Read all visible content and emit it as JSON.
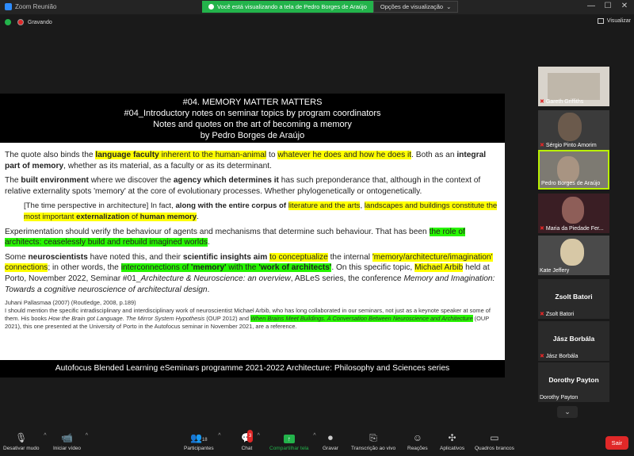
{
  "window": {
    "title": "Zoom Reunião",
    "minimize": "—",
    "maximize": "☐",
    "close": "✕"
  },
  "banner": {
    "text": "Você está visualizando a tela de Pedro Borges de Araújo",
    "options": "Opções de visualização"
  },
  "status": {
    "recording": "Gravando",
    "view": "Visualizar"
  },
  "slide": {
    "title": "#04. MEMORY MATTER MATTERS",
    "subtitle": "#04_Introductory notes on seminar topics by program coordinators",
    "subtitle2": "Notes and quotes on the art of becoming a memory",
    "author": "by Pedro Borges de Araújo",
    "footer": "Autofocus Blended Learning eSeminars programme 2021-2022 Architecture: Philosophy and Sciences series"
  },
  "participants": [
    {
      "name": "Gareth Griffiths",
      "video": true
    },
    {
      "name": "Sérgio Pinto Amorim",
      "video": true
    },
    {
      "name": "Pedro Borges de Araújo",
      "video": true,
      "active": true
    },
    {
      "name": "Maria da Piedade Fer...",
      "video": true
    },
    {
      "name": "Kate Jeffery",
      "video": true
    },
    {
      "name": "Zsolt Batori",
      "video": false
    },
    {
      "name": "Jász Borbála",
      "video": false
    },
    {
      "name": "Dorothy Payton",
      "video": false
    }
  ],
  "toolbar": {
    "mute": "Desativar mudo",
    "video": "Iniciar vídeo",
    "participants": "Participantes",
    "participants_count": "18",
    "chat": "Chat",
    "chat_badge": "3",
    "share": "Compartilhar tela",
    "record": "Gravar",
    "transcription": "Transcrição ao vivo",
    "reactions": "Reações",
    "apps": "Aplicativos",
    "whiteboard": "Quadros brancos",
    "leave": "Sair"
  },
  "colors": {
    "highlight_yellow": "#ffff00",
    "highlight_green": "#27f500",
    "zoom_green": "#23b34b",
    "leave_red": "#e02828",
    "active_border": "#b9f000"
  }
}
